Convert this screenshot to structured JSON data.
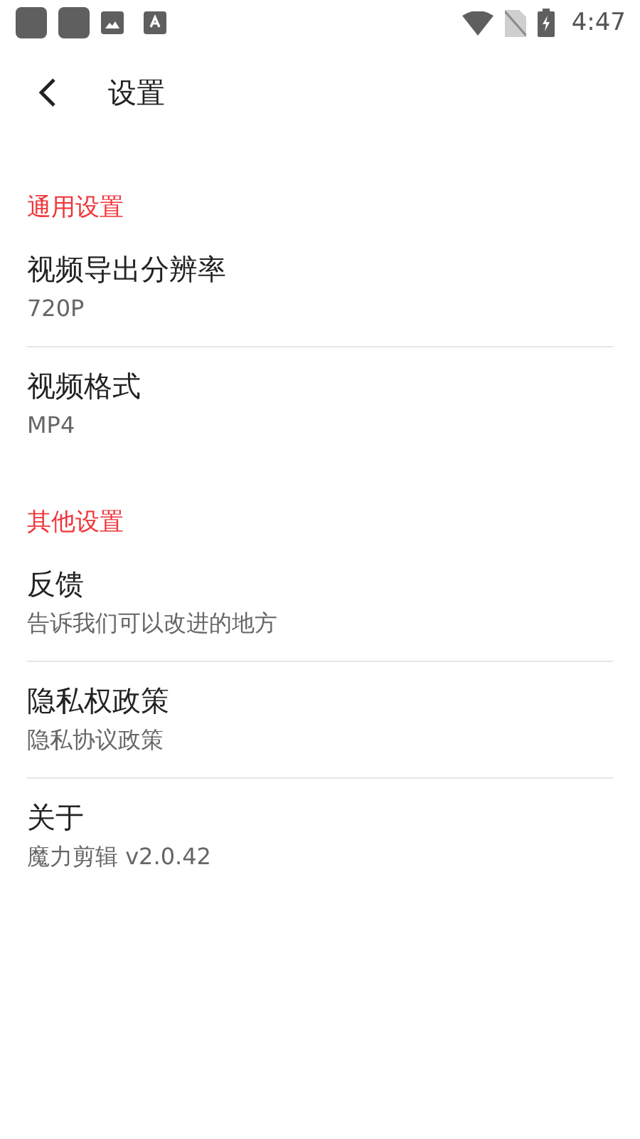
{
  "status_bar": {
    "time": "4:47"
  },
  "header": {
    "title": "设置"
  },
  "sections": [
    {
      "title": "通用设置",
      "items": [
        {
          "title": "视频导出分辨率",
          "subtitle": "720P"
        },
        {
          "title": "视频格式",
          "subtitle": "MP4"
        }
      ]
    },
    {
      "title": "其他设置",
      "items": [
        {
          "title": "反馈",
          "subtitle": "告诉我们可以改进的地方"
        },
        {
          "title": "隐私权政策",
          "subtitle": "隐私协议政策"
        },
        {
          "title": "关于",
          "subtitle": "魔力剪辑 v2.0.42"
        }
      ]
    }
  ]
}
